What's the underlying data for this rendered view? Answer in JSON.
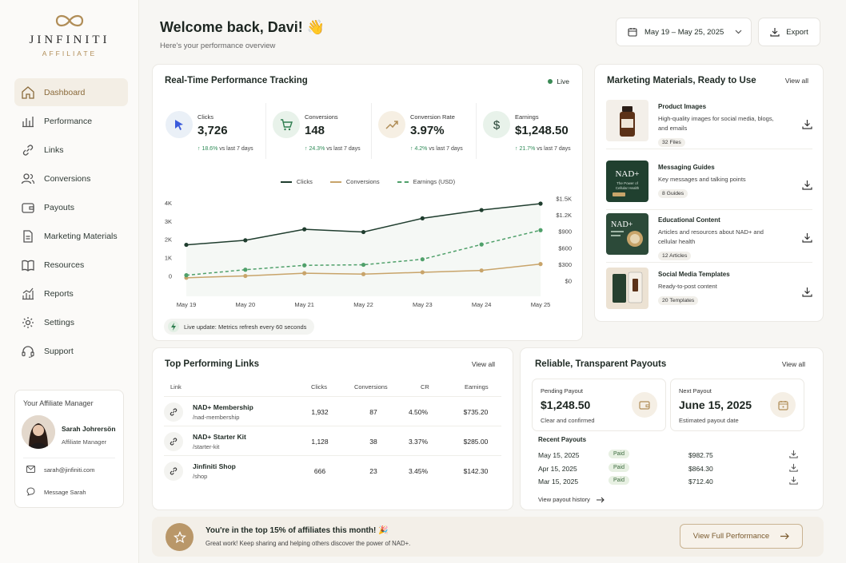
{
  "brand": {
    "name": "JINFINITI",
    "sub": "AFFILIATE"
  },
  "nav": [
    {
      "label": "Dashboard",
      "icon": "home-icon",
      "active": true
    },
    {
      "label": "Performance",
      "icon": "bar-chart-icon"
    },
    {
      "label": "Links",
      "icon": "link-icon"
    },
    {
      "label": "Conversions",
      "icon": "users-icon"
    },
    {
      "label": "Payouts",
      "icon": "wallet-icon"
    },
    {
      "label": "Marketing Materials",
      "icon": "document-icon"
    },
    {
      "label": "Resources",
      "icon": "book-icon"
    },
    {
      "label": "Reports",
      "icon": "report-icon"
    },
    {
      "label": "Settings",
      "icon": "gear-icon"
    },
    {
      "label": "Support",
      "icon": "headset-icon"
    }
  ],
  "manager": {
    "title": "Your Affiliate Manager",
    "name": "Sarah Johrersön",
    "role": "Affiliate Manager",
    "email": "sarah@jinfiniti.com",
    "message": "Message Sarah"
  },
  "header": {
    "title": "Welcome back, Davi! 👋",
    "subtitle": "Here's your performance overview",
    "date_range": "May 19 – May 25, 2025",
    "export": "Export"
  },
  "tracking": {
    "title": "Real-Time Performance Tracking",
    "live": "Live",
    "kpis": [
      {
        "label": "Clicks",
        "value": "3,726",
        "delta": "↑ 18.6%",
        "delta_suffix": " vs last 7 days",
        "icon": "cursor-icon",
        "icon_bg": "#eaf0f7",
        "icon_color": "#3b5bdb"
      },
      {
        "label": "Conversions",
        "value": "148",
        "delta": "↑ 24.3%",
        "delta_suffix": " vs last 7 days",
        "icon": "cart-icon",
        "icon_bg": "#e8f2ea",
        "icon_color": "#2e7d4f"
      },
      {
        "label": "Conversion Rate",
        "value": "3.97%",
        "delta": "↑ 4.2%",
        "delta_suffix": " vs last 7 days",
        "icon": "trend-up-icon",
        "icon_bg": "#f6efe3",
        "icon_color": "#b08d57"
      },
      {
        "label": "Earnings",
        "value": "$1,248.50",
        "delta": "↑ 21.7%",
        "delta_suffix": " vs last 7 days",
        "icon": "dollar-icon",
        "icon_bg": "#e8f2ea",
        "icon_color": "#1f3d2e"
      }
    ],
    "live_update": "Live update: Metrics refresh every 60 seconds"
  },
  "chart_data": {
    "type": "line",
    "categories": [
      "May 19",
      "May 20",
      "May 21",
      "May 22",
      "May 23",
      "May 24",
      "May 25"
    ],
    "series": [
      {
        "name": "Clicks",
        "axis": "left",
        "color": "#1f3d2e",
        "values": [
          1700,
          1950,
          2550,
          2400,
          3150,
          3600,
          3950
        ]
      },
      {
        "name": "Conversions",
        "axis": "left",
        "color": "#c8a46a",
        "values": [
          -100,
          0,
          150,
          100,
          200,
          300,
          650
        ]
      },
      {
        "name": "Earnings (USD)",
        "axis": "right",
        "color": "#4fa06a",
        "dashed": true,
        "values": [
          100,
          200,
          280,
          290,
          390,
          660,
          920
        ]
      }
    ],
    "y_left": {
      "ticks": [
        "0",
        "1K",
        "2K",
        "3K",
        "4K"
      ],
      "range": [
        -500,
        4300
      ]
    },
    "y_right": {
      "ticks": [
        "$0",
        "$300",
        "$600",
        "$900",
        "$1.2K",
        "$1.5K"
      ],
      "range": [
        -80,
        1520
      ]
    },
    "grid": false,
    "legend": "top"
  },
  "materials": {
    "title": "Marketing Materials, Ready to Use",
    "view_all": "View all",
    "items": [
      {
        "name": "Product Images",
        "desc": "High-quality images for social media, blogs, and emails",
        "badge": "32 Files",
        "thumb": "bottle"
      },
      {
        "name": "Messaging Guides",
        "desc": "Key messages and talking points",
        "badge": "8 Guides",
        "thumb": "nad",
        "thumb_text": "NAD+",
        "thumb_sub": "The Power of Cellular Health"
      },
      {
        "name": "Educational Content",
        "desc": "Articles and resources about NAD+ and cellular health",
        "badge": "12 Articles",
        "thumb": "nad2",
        "thumb_text": "NAD+"
      },
      {
        "name": "Social Media Templates",
        "desc": "Ready-to-post content",
        "badge": "20 Templates",
        "thumb": "phones"
      }
    ]
  },
  "links": {
    "title": "Top Performing Links",
    "view_all": "View all",
    "headers": [
      "Link",
      "Clicks",
      "Conversions",
      "CR",
      "Earnings"
    ],
    "rows": [
      {
        "name": "NAD+ Membership",
        "path": "/nad-membership",
        "clicks": "1,932",
        "conv": "87",
        "cr": "4.50%",
        "earn": "$735.20"
      },
      {
        "name": "NAD+ Starter Kit",
        "path": "/starter-kit",
        "clicks": "1,128",
        "conv": "38",
        "cr": "3.37%",
        "earn": "$285.00"
      },
      {
        "name": "Jinfiniti Shop",
        "path": "/shop",
        "clicks": "666",
        "conv": "23",
        "cr": "3.45%",
        "earn": "$142.30"
      }
    ]
  },
  "payouts": {
    "title": "Reliable, Transparent Payouts",
    "view_all": "View all",
    "pending": {
      "label": "Pending Payout",
      "value": "$1,248.50",
      "sub": "Clear and confirmed"
    },
    "next": {
      "label": "Next Payout",
      "value": "June 15, 2025",
      "sub": "Estimated payout date"
    },
    "recent_title": "Recent Payouts",
    "recent": [
      {
        "date": "May 15, 2025",
        "status": "Paid",
        "amount": "$982.75"
      },
      {
        "date": "Apr 15, 2025",
        "status": "Paid",
        "amount": "$864.30"
      },
      {
        "date": "Mar 15, 2025",
        "status": "Paid",
        "amount": "$712.40"
      }
    ],
    "history": "View payout history"
  },
  "banner": {
    "title": "You're in the top 15% of affiliates this month! 🎉",
    "sub": "Great work! Keep sharing and helping others discover the power of NAD+.",
    "button": "View Full Performance"
  }
}
